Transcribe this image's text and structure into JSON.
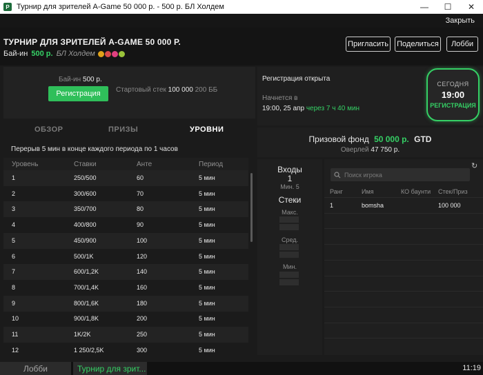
{
  "window": {
    "title": "Турнир для зрителей A-Game 50 000 р. - 500 р. БЛ Холдем",
    "minimize": "—",
    "maximize": "☐",
    "close": "✕"
  },
  "topbar": {
    "close_label": "Закрыть"
  },
  "header": {
    "title": "ТУРНИР ДЛЯ ЗРИТЕЛЕЙ A-GAME 50 000 Р.",
    "buyin_label": "Бай-ин",
    "buyin_value": "500 р.",
    "game": "БЛ Холдем",
    "badge_colors": [
      "#e0a21a",
      "#d84a4a",
      "#e04080",
      "#9ac23a"
    ],
    "buttons": {
      "invite": "Пригласить",
      "share": "Поделиться",
      "lobby": "Лобби"
    }
  },
  "registration": {
    "buyin_label": "Бай-ин",
    "buyin_value": "500 р.",
    "register_button": "Регистрация",
    "start_stack_label": "Стартовый стек",
    "start_stack_value": "100 000",
    "start_stack_bb": "200 ББ"
  },
  "status": {
    "reg_open": "Регистрация открыта",
    "starts_label": "Начнется в",
    "starts_time": "19:00, 25 апр",
    "starts_in": "через 7 ч 40 мин",
    "badge": {
      "line1": "СЕГОДНЯ",
      "line2": "19:00",
      "line3": "РЕГИСТРАЦИЯ"
    }
  },
  "tabs": {
    "overview": "ОБЗОР",
    "prizes": "ПРИЗЫ",
    "levels": "УРОВНИ"
  },
  "levels": {
    "break_note": "Перерыв 5 мин в конце каждого периода по 1 часов",
    "headers": {
      "level": "Уровень",
      "stakes": "Ставки",
      "ante": "Анте",
      "period": "Период"
    },
    "rows": [
      {
        "level": "1",
        "stakes": "250/500",
        "ante": "60",
        "period": "5 мин"
      },
      {
        "level": "2",
        "stakes": "300/600",
        "ante": "70",
        "period": "5 мин"
      },
      {
        "level": "3",
        "stakes": "350/700",
        "ante": "80",
        "period": "5 мин"
      },
      {
        "level": "4",
        "stakes": "400/800",
        "ante": "90",
        "period": "5 мин"
      },
      {
        "level": "5",
        "stakes": "450/900",
        "ante": "100",
        "period": "5 мин"
      },
      {
        "level": "6",
        "stakes": "500/1K",
        "ante": "120",
        "period": "5 мин"
      },
      {
        "level": "7",
        "stakes": "600/1,2K",
        "ante": "140",
        "period": "5 мин"
      },
      {
        "level": "8",
        "stakes": "700/1,4K",
        "ante": "160",
        "period": "5 мин"
      },
      {
        "level": "9",
        "stakes": "800/1,6K",
        "ante": "180",
        "period": "5 мин"
      },
      {
        "level": "10",
        "stakes": "900/1,8K",
        "ante": "200",
        "period": "5 мин"
      },
      {
        "level": "11",
        "stakes": "1K/2K",
        "ante": "250",
        "period": "5 мин"
      },
      {
        "level": "12",
        "stakes": "1 250/2,5K",
        "ante": "300",
        "period": "5 мин"
      }
    ]
  },
  "prize": {
    "label": "Призовой фонд",
    "amount": "50 000 р.",
    "gtd": "GTD",
    "overlay_label": "Оверлей",
    "overlay_value": "47 750 р."
  },
  "entries": {
    "title": "Входы",
    "count": "1",
    "min": "Мин. 5",
    "stacks_title": "Стеки",
    "max_label": "Макс.",
    "avg_label": "Сред.",
    "min_label": "Мин."
  },
  "players": {
    "search_placeholder": "Поиск игрока",
    "headers": {
      "rank": "Ранг",
      "name": "Имя",
      "ko": "КО баунти",
      "stack": "Стек/Приз"
    },
    "rows": [
      {
        "rank": "1",
        "name": "bomsha",
        "ko": "",
        "stack": "100 000"
      }
    ]
  },
  "taskbar": {
    "lobby": "Лобби",
    "tournament": "Турнир для зрит...",
    "clock": "11:19"
  },
  "colors": {
    "accent_green": "#35d065",
    "button_green": "#2fbf5a",
    "background": "#1b1b1b"
  }
}
